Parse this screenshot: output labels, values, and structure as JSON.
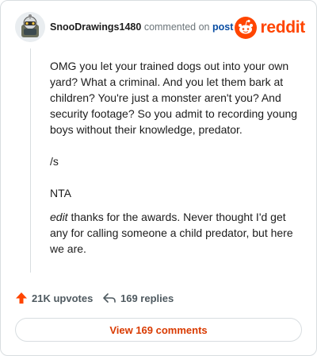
{
  "comment": {
    "username": "SnooDrawings1480",
    "commented_text": "commented on",
    "post_link": "post",
    "body_p1": "OMG you let your trained dogs out into your own yard? What a criminal. And you let them bark at children? You're just a monster aren't you? And security footage? So you admit to recording young boys without their knowledge, predator.",
    "body_p2": "/s",
    "body_p3": "NTA",
    "body_p4_italic": "edit",
    "body_p4_rest": " thanks for the awards. Never thought I'd get any for calling someone a child predator, but here we are."
  },
  "brand": {
    "logo_text": "reddit",
    "color": "#ff4500"
  },
  "actions": {
    "upvotes": "21K upvotes",
    "replies": "169 replies",
    "view_comments": "View 169 comments",
    "upvote_color": "#ff4500"
  },
  "icons": [
    "avatar-icon",
    "reddit-logo-icon",
    "upvote-arrow-icon",
    "reply-arrow-icon"
  ]
}
